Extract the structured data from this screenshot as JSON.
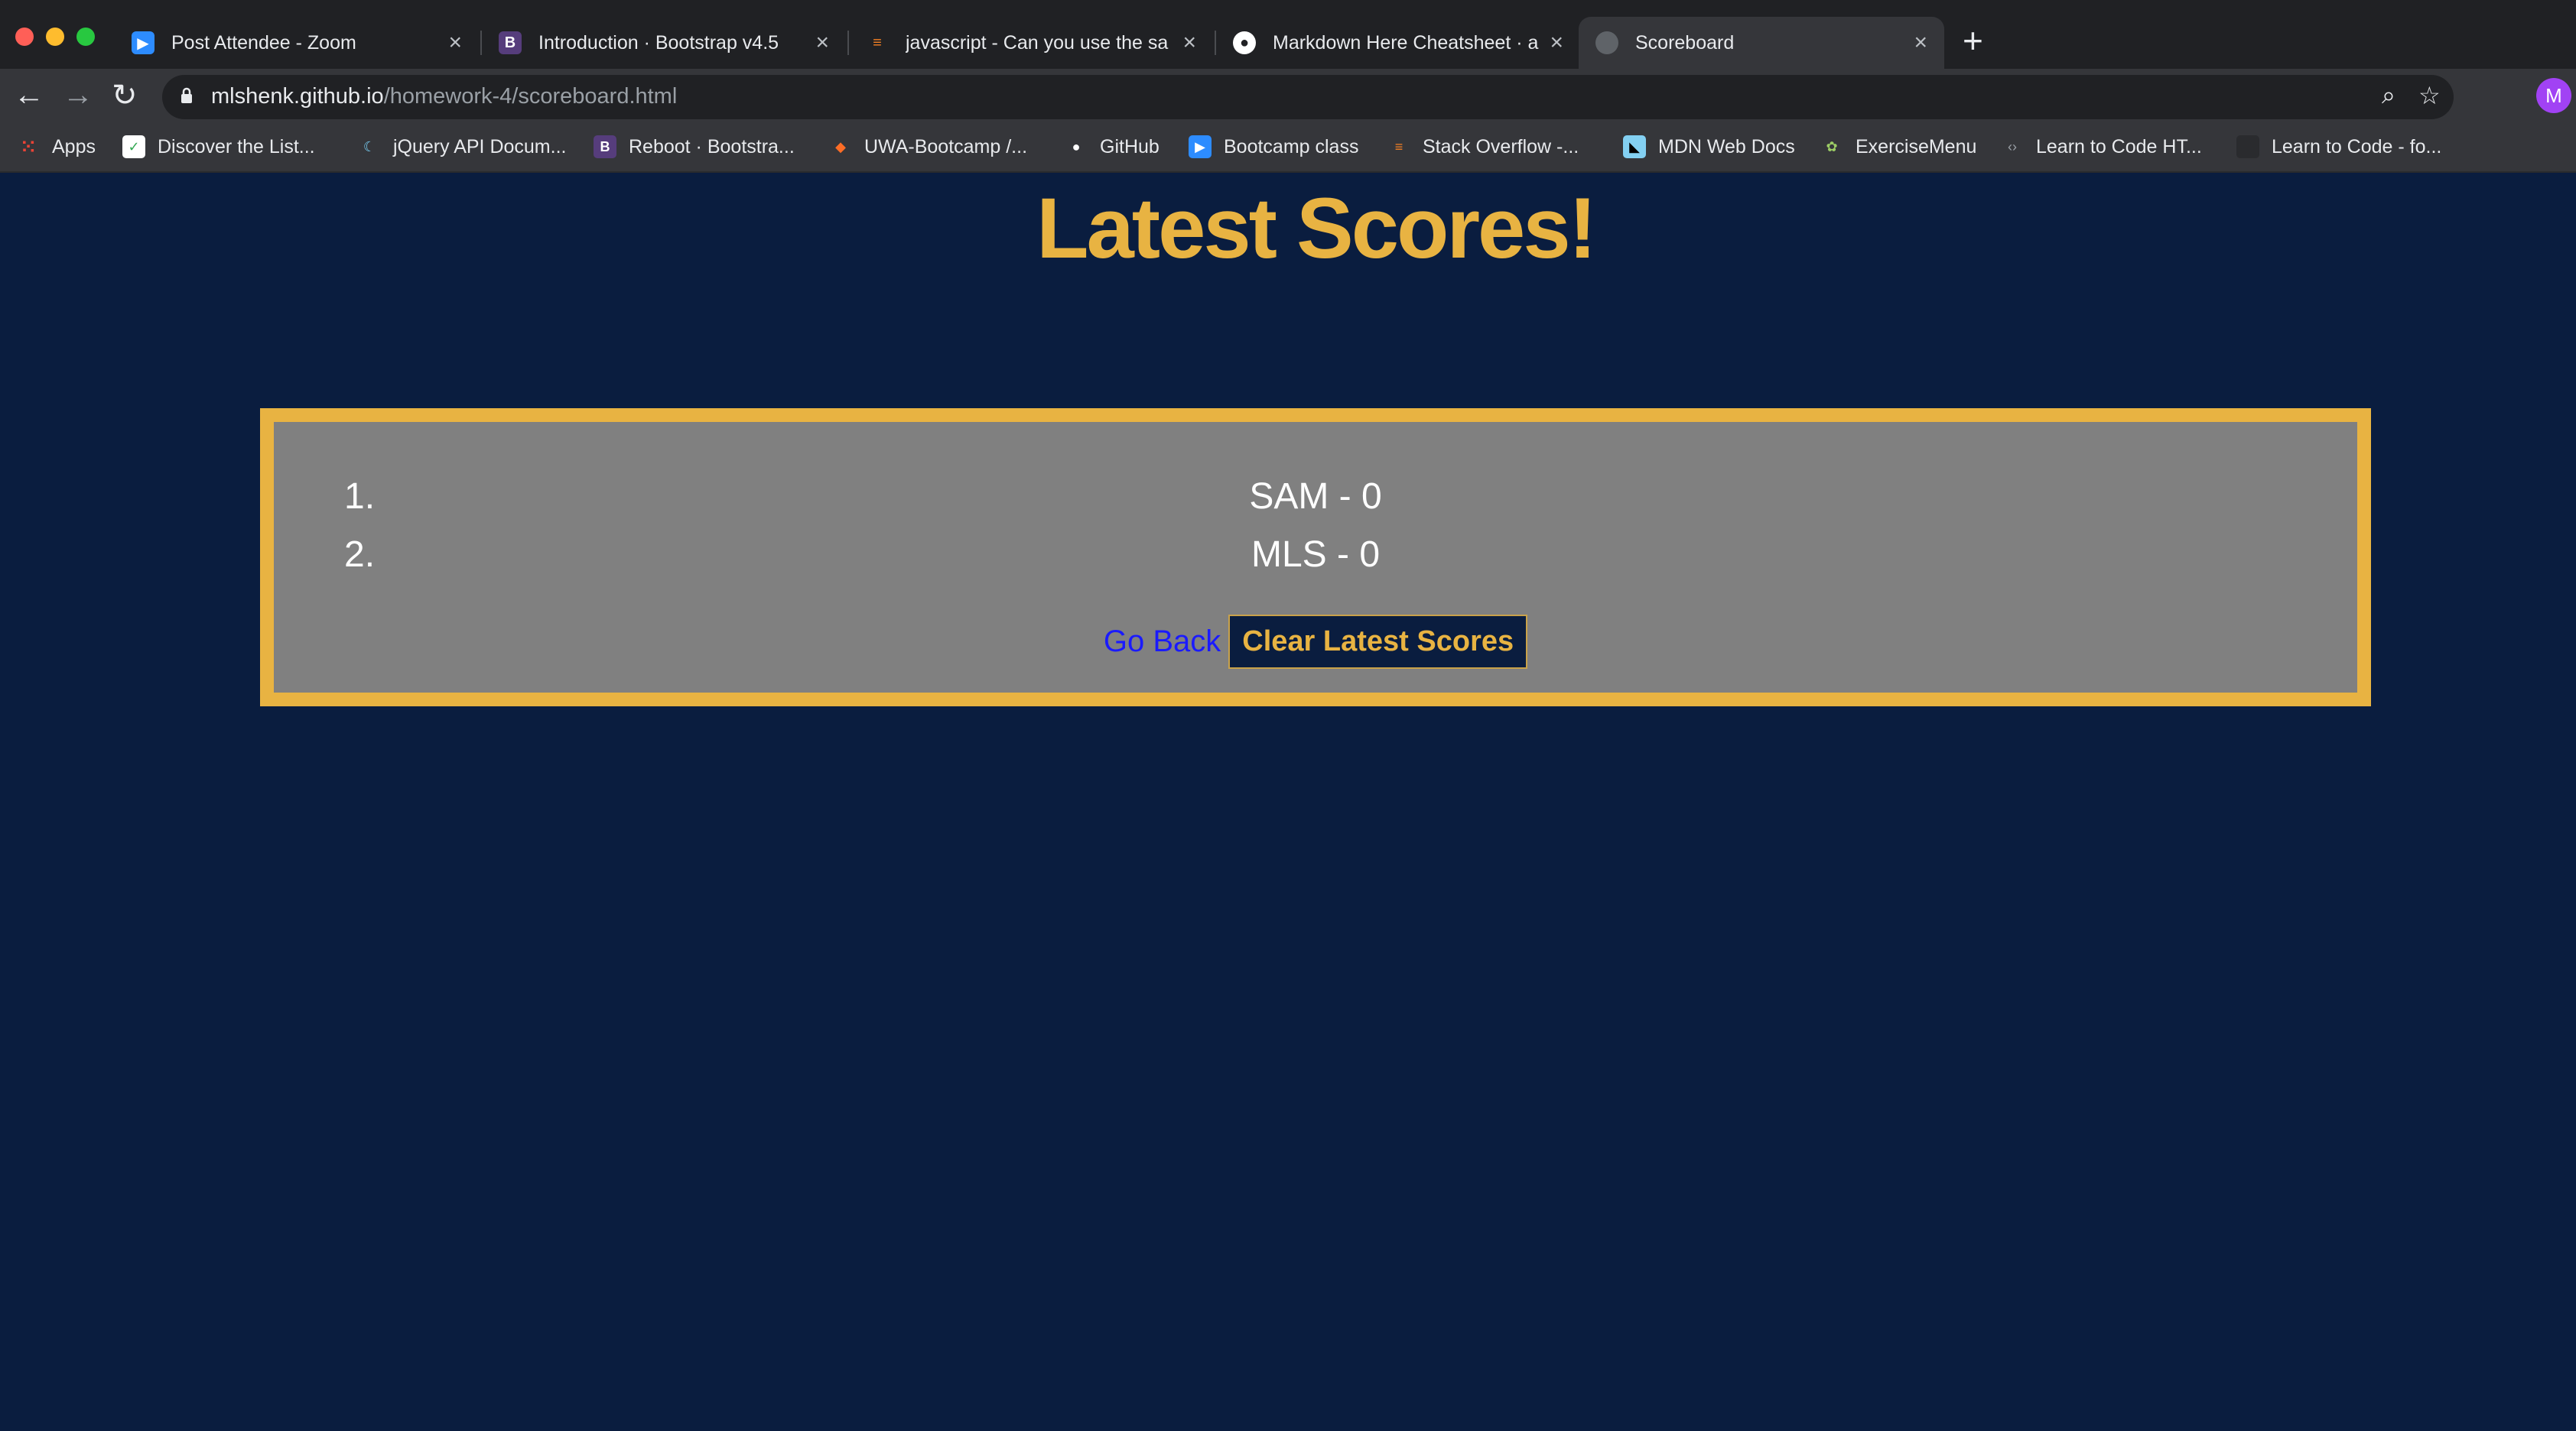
{
  "browser": {
    "tabs": [
      {
        "label": "Post Attendee - Zoom",
        "icon": "zoom-icon",
        "color": "#2d8cff"
      },
      {
        "label": "Introduction · Bootstrap v4.5",
        "icon": "bootstrap-icon",
        "color": "#563d7c"
      },
      {
        "label": "javascript - Can you use the sa",
        "icon": "stackoverflow-icon",
        "color": "#f48024"
      },
      {
        "label": "Markdown Here Cheatsheet · a",
        "icon": "github-icon",
        "color": "#ffffff"
      },
      {
        "label": "Scoreboard",
        "icon": "globe-icon",
        "color": "#5f6368"
      }
    ],
    "url_host": "mlshenk.github.io",
    "url_path": "/homework-4/scoreboard.html",
    "avatar_letter": "M",
    "bookmarks": [
      {
        "label": "Apps",
        "icon": "apps-grid-icon"
      },
      {
        "label": "Discover the List...",
        "icon": "list-icon"
      },
      {
        "label": "jQuery API Docum...",
        "icon": "jquery-icon"
      },
      {
        "label": "Reboot · Bootstra...",
        "icon": "bootstrap-icon"
      },
      {
        "label": "UWA-Bootcamp /...",
        "icon": "gitlab-icon"
      },
      {
        "label": "GitHub",
        "icon": "github-icon"
      },
      {
        "label": "Bootcamp class",
        "icon": "zoom-icon"
      },
      {
        "label": "Stack Overflow -...",
        "icon": "stackoverflow-icon"
      },
      {
        "label": "MDN Web Docs",
        "icon": "mdn-icon"
      },
      {
        "label": "ExerciseMenu",
        "icon": "exercise-icon"
      },
      {
        "label": "Learn to Code HT...",
        "icon": "code-icon"
      },
      {
        "label": "Learn to Code - fo...",
        "icon": "freecodecamp-icon"
      }
    ]
  },
  "page": {
    "title": "Latest Scores!",
    "scores": [
      {
        "num": "1.",
        "text": "SAM - 0"
      },
      {
        "num": "2.",
        "text": "MLS - 0"
      }
    ],
    "go_back_label": "Go Back",
    "clear_label": "Clear Latest Scores"
  },
  "colors": {
    "background": "#0a1d3f",
    "accent": "#e8b342",
    "panel": "#808080",
    "link": "#1a1aff"
  }
}
